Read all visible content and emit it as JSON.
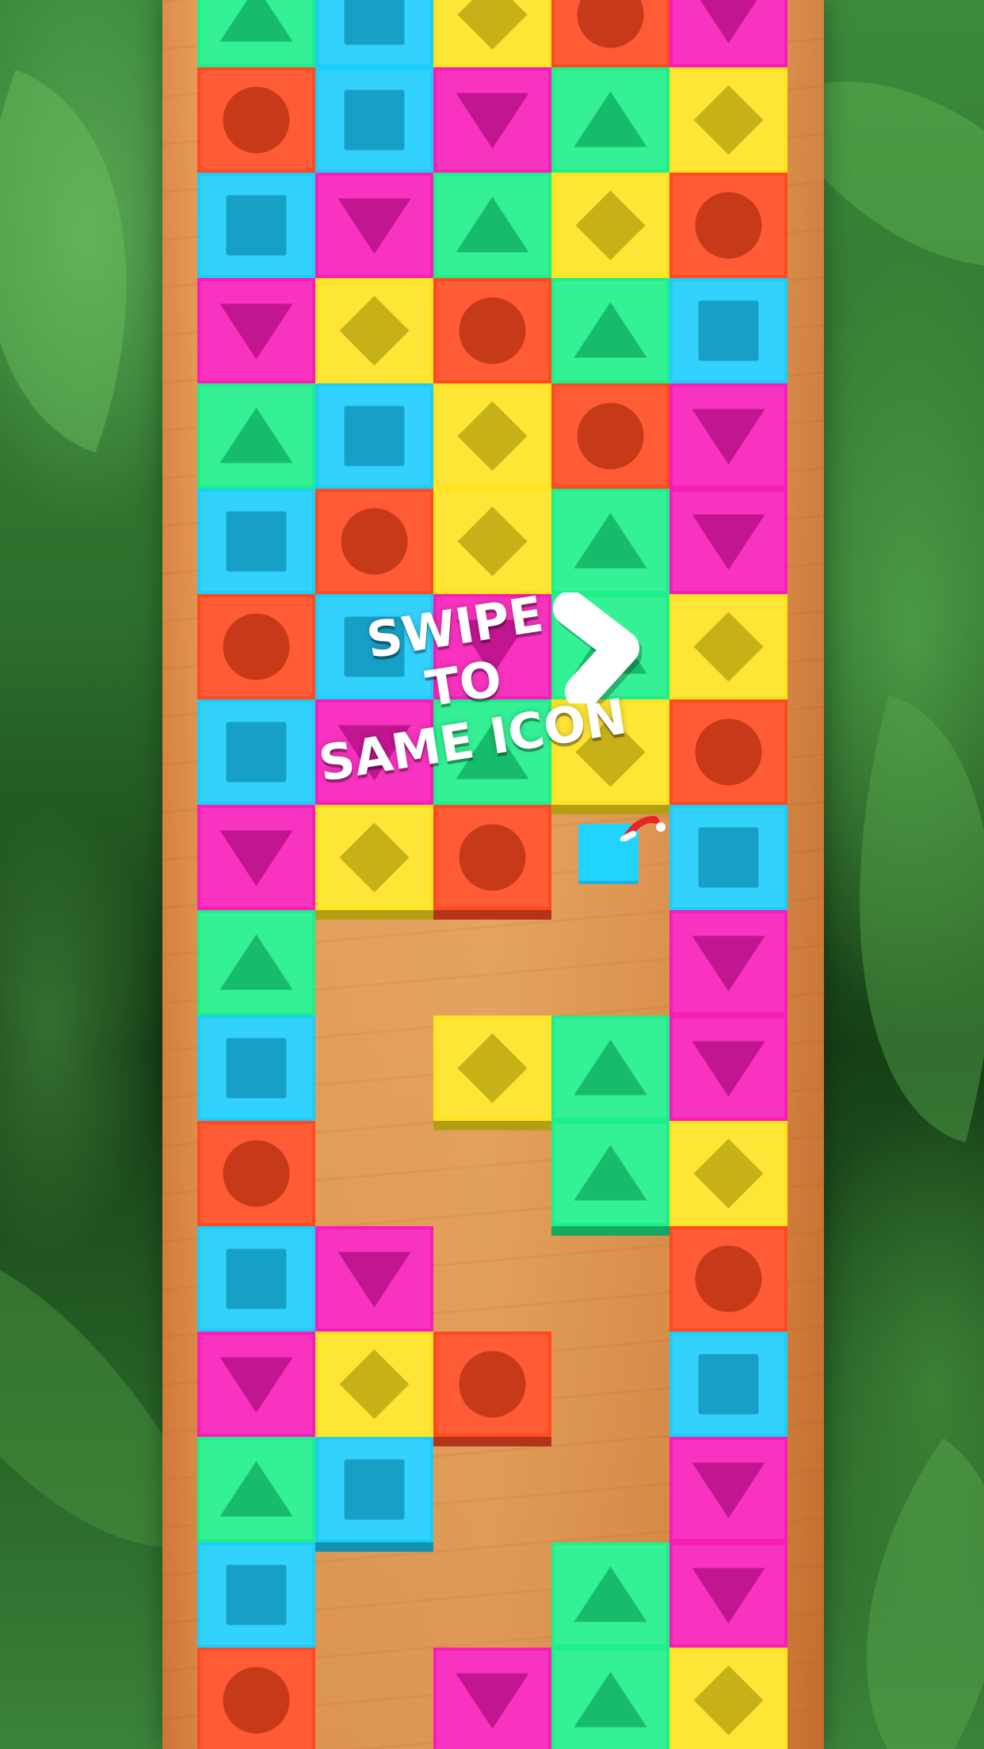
{
  "hint": {
    "line1": "SWIPE",
    "line2": "TO",
    "line3": "SAME ICON"
  },
  "palette": {
    "circle": "#ff4a20",
    "square": "#1ccdfc",
    "triangle": "#1df08a",
    "diamond": "#ffe31f",
    "inverted_triangle": "#f81cb8"
  },
  "icons": {
    "circle": "circle-icon",
    "square": "square-icon",
    "triangle": "triangle-icon",
    "diamond": "diamond-icon",
    "inverted_triangle": "inverted-triangle-icon"
  },
  "board": {
    "columns": 5,
    "rows": [
      [
        "triangle",
        "square",
        "diamond",
        "circle",
        "inverted_triangle"
      ],
      [
        "circle",
        "square",
        "inverted_triangle",
        "triangle",
        "diamond"
      ],
      [
        "square",
        "inverted_triangle",
        "triangle",
        "diamond",
        "circle"
      ],
      [
        "inverted_triangle",
        "diamond",
        "circle",
        "triangle",
        "square"
      ],
      [
        "triangle",
        "square",
        "diamond",
        "circle",
        "inverted_triangle"
      ],
      [
        "square",
        "circle",
        "diamond",
        "triangle",
        "inverted_triangle"
      ],
      [
        "circle",
        "square",
        "inverted_triangle",
        "triangle",
        "diamond"
      ],
      [
        "square",
        "inverted_triangle",
        "triangle",
        "diamond",
        "circle"
      ],
      [
        "inverted_triangle",
        "diamond",
        "circle",
        null,
        "square"
      ],
      [
        "triangle",
        null,
        null,
        null,
        "inverted_triangle"
      ],
      [
        "square",
        null,
        "diamond",
        "triangle",
        "inverted_triangle"
      ],
      [
        "circle",
        null,
        null,
        "triangle",
        "diamond"
      ],
      [
        "square",
        "inverted_triangle",
        null,
        null,
        "circle"
      ],
      [
        "inverted_triangle",
        "diamond",
        "circle",
        null,
        "square"
      ],
      [
        "triangle",
        "square",
        null,
        null,
        "inverted_triangle"
      ],
      [
        "square",
        null,
        null,
        "triangle",
        "inverted_triangle"
      ],
      [
        "circle",
        null,
        "inverted_triangle",
        "triangle",
        "diamond"
      ]
    ]
  },
  "dragged_tile": {
    "shape": "square",
    "has_santa_hat": true
  }
}
